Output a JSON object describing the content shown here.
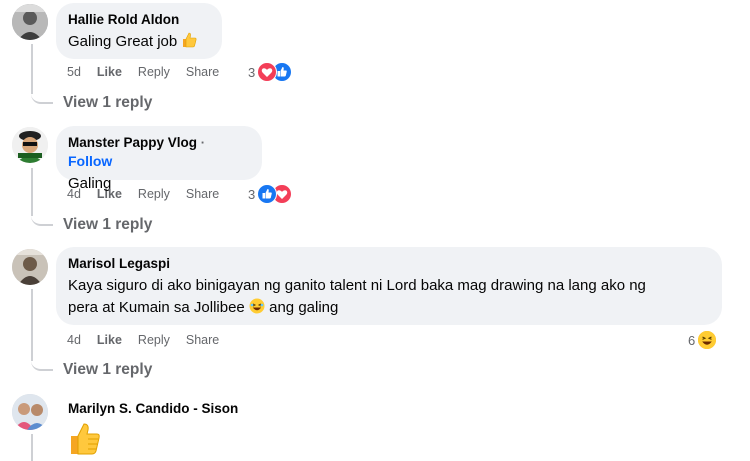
{
  "comments": [
    {
      "author": "Hallie Rold Aldon",
      "text": "Galing Great job",
      "text_emoji": "thumbs-up",
      "time": "5d",
      "like": "Like",
      "reply": "Reply",
      "share": "Share",
      "reaction_count": "3",
      "view_reply": "View 1 reply"
    },
    {
      "author": "Manster Pappy Vlog",
      "follow_sep": "·",
      "follow": "Follow",
      "text": "Galing",
      "time": "4d",
      "like": "Like",
      "reply": "Reply",
      "share": "Share",
      "reaction_count": "3",
      "view_reply": "View 1 reply"
    },
    {
      "author": "Marisol Legaspi",
      "text_line1": "Kaya siguro di ako binigayan ng ganito talent ni Lord baka mag drawing na lang ako ng",
      "text_line2a": "pera at Kumain sa Jollibee",
      "text_line2b": "ang galing",
      "time": "4d",
      "like": "Like",
      "reply": "Reply",
      "share": "Share",
      "reaction_count": "6",
      "view_reply": "View 1 reply"
    },
    {
      "author": "Marilyn S. Candido - Sison",
      "sticker": "thumbs-up"
    }
  ],
  "colors": {
    "bubble": "#f0f2f5",
    "secondary_text": "#65676b",
    "link": "#0866ff",
    "like": "#1877f2",
    "love": "#f33e58",
    "haha": "#f7b125"
  }
}
